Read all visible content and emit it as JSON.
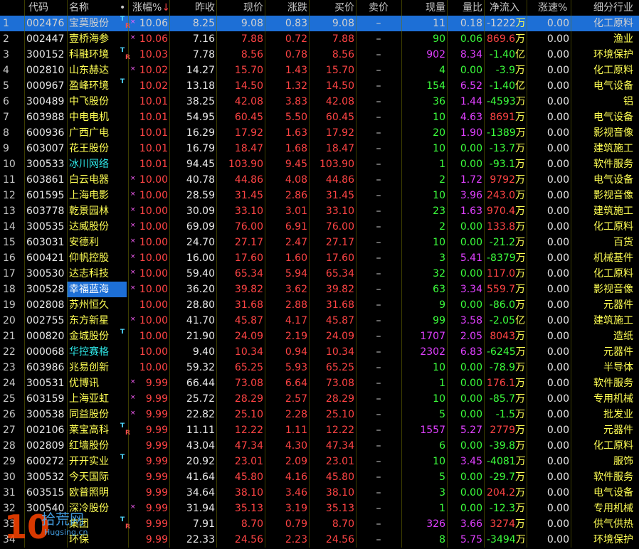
{
  "headers": {
    "idx": "",
    "code": "代码",
    "name": "名称",
    "dot": "•",
    "pct": "涨幅%",
    "pct_arrow": "↓",
    "prev": "昨收",
    "cur": "现价",
    "chg": "涨跌",
    "bid": "买价",
    "ask": "卖价",
    "vol": "现量",
    "ratio": "量比",
    "flow": "净流入",
    "speed": "涨速%",
    "ind": "细分行业"
  },
  "colors": {
    "up": "#ff4444",
    "flat": "#e8e8e8",
    "selected_row": "#1d6fd6",
    "industry": "#ffff54"
  },
  "rows": [
    {
      "idx": "1",
      "code": "002476",
      "name": "宝莫股份",
      "t": true,
      "r": true,
      "x": true,
      "pct": "10.06",
      "prev": "8.25",
      "cur": "9.08",
      "chg": "0.83",
      "bid": "9.08",
      "ask": "–",
      "vol": "11",
      "ratio": "0.18",
      "flow_n": "-1222",
      "flow_u": "万",
      "speed": "0.00",
      "ind": "化工原料",
      "sel": true
    },
    {
      "idx": "2",
      "code": "002447",
      "name": "壹桥海参",
      "t": false,
      "r": false,
      "x": true,
      "pct": "10.06",
      "prev": "7.16",
      "cur": "7.88",
      "chg": "0.72",
      "bid": "7.88",
      "ask": "–",
      "vol": "90",
      "ratio": "0.06",
      "flow_n": "869.6",
      "flow_u": "万",
      "speed": "0.00",
      "ind": "渔业"
    },
    {
      "idx": "3",
      "code": "300152",
      "name": "科融环境",
      "t": true,
      "r": true,
      "x": false,
      "pct": "10.03",
      "prev": "7.78",
      "cur": "8.56",
      "chg": "0.78",
      "bid": "8.56",
      "ask": "–",
      "vol": "902",
      "ratio": "8.34",
      "flow_n": "-1.40",
      "flow_u": "亿",
      "speed": "0.00",
      "ind": "环境保护"
    },
    {
      "idx": "4",
      "code": "002810",
      "name": "山东赫达",
      "t": false,
      "r": false,
      "x": true,
      "pct": "10.02",
      "prev": "14.27",
      "cur": "15.70",
      "chg": "1.43",
      "bid": "15.70",
      "ask": "–",
      "vol": "4",
      "ratio": "0.00",
      "flow_n": "-3.9",
      "flow_u": "万",
      "speed": "0.00",
      "ind": "化工原料"
    },
    {
      "idx": "5",
      "code": "000967",
      "name": "盈峰环境",
      "t": true,
      "r": false,
      "x": false,
      "pct": "10.02",
      "prev": "13.18",
      "cur": "14.50",
      "chg": "1.32",
      "bid": "14.50",
      "ask": "–",
      "vol": "154",
      "ratio": "6.52",
      "flow_n": "-1.40",
      "flow_u": "亿",
      "speed": "0.00",
      "ind": "电气设备"
    },
    {
      "idx": "6",
      "code": "300489",
      "name": "中飞股份",
      "t": false,
      "r": false,
      "x": false,
      "pct": "10.01",
      "prev": "38.25",
      "cur": "42.08",
      "chg": "3.83",
      "bid": "42.08",
      "ask": "–",
      "vol": "36",
      "ratio": "1.44",
      "flow_n": "-4593",
      "flow_u": "万",
      "speed": "0.00",
      "ind": "铝"
    },
    {
      "idx": "7",
      "code": "603988",
      "name": "中电电机",
      "t": false,
      "r": false,
      "x": false,
      "pct": "10.01",
      "prev": "54.95",
      "cur": "60.45",
      "chg": "5.50",
      "bid": "60.45",
      "ask": "–",
      "vol": "10",
      "ratio": "4.63",
      "flow_n": "8691",
      "flow_u": "万",
      "speed": "0.00",
      "ind": "电气设备"
    },
    {
      "idx": "8",
      "code": "600936",
      "name": "广西广电",
      "t": false,
      "r": false,
      "x": false,
      "pct": "10.01",
      "prev": "16.29",
      "cur": "17.92",
      "chg": "1.63",
      "bid": "17.92",
      "ask": "–",
      "vol": "20",
      "ratio": "1.90",
      "flow_n": "-1389",
      "flow_u": "万",
      "speed": "0.00",
      "ind": "影视音像"
    },
    {
      "idx": "9",
      "code": "603007",
      "name": "花王股份",
      "t": false,
      "r": false,
      "x": false,
      "pct": "10.01",
      "prev": "16.79",
      "cur": "18.47",
      "chg": "1.68",
      "bid": "18.47",
      "ask": "–",
      "vol": "10",
      "ratio": "0.00",
      "flow_n": "-13.7",
      "flow_u": "万",
      "speed": "0.00",
      "ind": "建筑施工"
    },
    {
      "idx": "10",
      "code": "300533",
      "name": "冰川网络",
      "t": false,
      "r": false,
      "x": false,
      "teal": true,
      "pct": "10.01",
      "prev": "94.45",
      "cur": "103.90",
      "chg": "9.45",
      "bid": "103.90",
      "ask": "–",
      "vol": "1",
      "ratio": "0.00",
      "flow_n": "-93.1",
      "flow_u": "万",
      "speed": "0.00",
      "ind": "软件服务"
    },
    {
      "idx": "11",
      "code": "603861",
      "name": "白云电器",
      "t": false,
      "r": false,
      "x": true,
      "pct": "10.00",
      "prev": "40.78",
      "cur": "44.86",
      "chg": "4.08",
      "bid": "44.86",
      "ask": "–",
      "vol": "2",
      "ratio": "1.72",
      "flow_n": "9792",
      "flow_u": "万",
      "speed": "0.00",
      "ind": "电气设备"
    },
    {
      "idx": "12",
      "code": "601595",
      "name": "上海电影",
      "t": false,
      "r": false,
      "x": true,
      "pct": "10.00",
      "prev": "28.59",
      "cur": "31.45",
      "chg": "2.86",
      "bid": "31.45",
      "ask": "–",
      "vol": "10",
      "ratio": "3.96",
      "flow_n": "243.0",
      "flow_u": "万",
      "speed": "0.00",
      "ind": "影视音像"
    },
    {
      "idx": "13",
      "code": "603778",
      "name": "乾景园林",
      "t": false,
      "r": false,
      "x": true,
      "pct": "10.00",
      "prev": "30.09",
      "cur": "33.10",
      "chg": "3.01",
      "bid": "33.10",
      "ask": "–",
      "vol": "23",
      "ratio": "1.63",
      "flow_n": "970.4",
      "flow_u": "万",
      "speed": "0.00",
      "ind": "建筑施工"
    },
    {
      "idx": "14",
      "code": "300535",
      "name": "达威股份",
      "t": false,
      "r": false,
      "x": true,
      "pct": "10.00",
      "prev": "69.09",
      "cur": "76.00",
      "chg": "6.91",
      "bid": "76.00",
      "ask": "–",
      "vol": "2",
      "ratio": "0.00",
      "flow_n": "133.8",
      "flow_u": "万",
      "speed": "0.00",
      "ind": "化工原料"
    },
    {
      "idx": "15",
      "code": "603031",
      "name": "安德利",
      "t": false,
      "r": false,
      "x": true,
      "pct": "10.00",
      "prev": "24.70",
      "cur": "27.17",
      "chg": "2.47",
      "bid": "27.17",
      "ask": "–",
      "vol": "10",
      "ratio": "0.00",
      "flow_n": "-21.2",
      "flow_u": "万",
      "speed": "0.00",
      "ind": "百货"
    },
    {
      "idx": "16",
      "code": "600421",
      "name": "仰帆控股",
      "t": false,
      "r": false,
      "x": true,
      "pct": "10.00",
      "prev": "16.00",
      "cur": "17.60",
      "chg": "1.60",
      "bid": "17.60",
      "ask": "–",
      "vol": "3",
      "ratio": "5.41",
      "flow_n": "-8379",
      "flow_u": "万",
      "speed": "0.00",
      "ind": "机械基件"
    },
    {
      "idx": "17",
      "code": "300530",
      "name": "达志科技",
      "t": false,
      "r": false,
      "x": true,
      "pct": "10.00",
      "prev": "59.40",
      "cur": "65.34",
      "chg": "5.94",
      "bid": "65.34",
      "ask": "–",
      "vol": "32",
      "ratio": "0.00",
      "flow_n": "117.0",
      "flow_u": "万",
      "speed": "0.00",
      "ind": "化工原料"
    },
    {
      "idx": "18",
      "code": "300528",
      "name": "幸福蓝海",
      "hl": true,
      "t": false,
      "r": false,
      "x": true,
      "pct": "10.00",
      "prev": "36.20",
      "cur": "39.82",
      "chg": "3.62",
      "bid": "39.82",
      "ask": "–",
      "vol": "63",
      "ratio": "3.34",
      "flow_n": "559.7",
      "flow_u": "万",
      "speed": "0.00",
      "ind": "影视音像"
    },
    {
      "idx": "19",
      "code": "002808",
      "name": "苏州恒久",
      "t": false,
      "r": false,
      "x": false,
      "pct": "10.00",
      "prev": "28.80",
      "cur": "31.68",
      "chg": "2.88",
      "bid": "31.68",
      "ask": "–",
      "vol": "9",
      "ratio": "0.00",
      "flow_n": "-86.0",
      "flow_u": "万",
      "speed": "0.00",
      "ind": "元器件"
    },
    {
      "idx": "20",
      "code": "002755",
      "name": "东方新星",
      "t": false,
      "r": false,
      "x": true,
      "pct": "10.00",
      "prev": "41.70",
      "cur": "45.87",
      "chg": "4.17",
      "bid": "45.87",
      "ask": "–",
      "vol": "99",
      "ratio": "3.58",
      "flow_n": "-2.05",
      "flow_u": "亿",
      "speed": "0.00",
      "ind": "建筑施工"
    },
    {
      "idx": "21",
      "code": "000820",
      "name": "金城股份",
      "t": true,
      "r": false,
      "x": false,
      "pct": "10.00",
      "prev": "21.90",
      "cur": "24.09",
      "chg": "2.19",
      "bid": "24.09",
      "ask": "–",
      "vol": "1707",
      "ratio": "2.05",
      "flow_n": "8043",
      "flow_u": "万",
      "speed": "0.00",
      "ind": "造纸"
    },
    {
      "idx": "22",
      "code": "000068",
      "name": "华控赛格",
      "t": false,
      "r": false,
      "x": false,
      "teal": true,
      "pct": "10.00",
      "prev": "9.40",
      "cur": "10.34",
      "chg": "0.94",
      "bid": "10.34",
      "ask": "–",
      "vol": "2302",
      "ratio": "6.83",
      "flow_n": "-6245",
      "flow_u": "万",
      "speed": "0.00",
      "ind": "元器件"
    },
    {
      "idx": "23",
      "code": "603986",
      "name": "兆易创新",
      "t": false,
      "r": false,
      "x": false,
      "pct": "10.00",
      "prev": "59.32",
      "cur": "65.25",
      "chg": "5.93",
      "bid": "65.25",
      "ask": "–",
      "vol": "10",
      "ratio": "0.00",
      "flow_n": "-78.9",
      "flow_u": "万",
      "speed": "0.00",
      "ind": "半导体"
    },
    {
      "idx": "24",
      "code": "300531",
      "name": "优博讯",
      "t": false,
      "r": false,
      "x": true,
      "pct": "9.99",
      "prev": "66.44",
      "cur": "73.08",
      "chg": "6.64",
      "bid": "73.08",
      "ask": "–",
      "vol": "1",
      "ratio": "0.00",
      "flow_n": "176.1",
      "flow_u": "万",
      "speed": "0.00",
      "ind": "软件服务"
    },
    {
      "idx": "25",
      "code": "603159",
      "name": "上海亚虹",
      "t": false,
      "r": false,
      "x": true,
      "pct": "9.99",
      "prev": "25.72",
      "cur": "28.29",
      "chg": "2.57",
      "bid": "28.29",
      "ask": "–",
      "vol": "10",
      "ratio": "0.00",
      "flow_n": "-85.7",
      "flow_u": "万",
      "speed": "0.00",
      "ind": "专用机械"
    },
    {
      "idx": "26",
      "code": "300538",
      "name": "同益股份",
      "t": false,
      "r": false,
      "x": true,
      "pct": "9.99",
      "prev": "22.82",
      "cur": "25.10",
      "chg": "2.28",
      "bid": "25.10",
      "ask": "–",
      "vol": "5",
      "ratio": "0.00",
      "flow_n": "-1.5",
      "flow_u": "万",
      "speed": "0.00",
      "ind": "批发业"
    },
    {
      "idx": "27",
      "code": "002106",
      "name": "莱宝高科",
      "t": true,
      "r": true,
      "x": false,
      "pct": "9.99",
      "prev": "11.11",
      "cur": "12.22",
      "chg": "1.11",
      "bid": "12.22",
      "ask": "–",
      "vol": "1557",
      "ratio": "5.27",
      "flow_n": "2779",
      "flow_u": "万",
      "speed": "0.00",
      "ind": "元器件"
    },
    {
      "idx": "28",
      "code": "002809",
      "name": "红墙股份",
      "t": false,
      "r": false,
      "x": false,
      "pct": "9.99",
      "prev": "43.04",
      "cur": "47.34",
      "chg": "4.30",
      "bid": "47.34",
      "ask": "–",
      "vol": "6",
      "ratio": "0.00",
      "flow_n": "-39.8",
      "flow_u": "万",
      "speed": "0.00",
      "ind": "化工原料"
    },
    {
      "idx": "29",
      "code": "600272",
      "name": "开开实业",
      "t": true,
      "r": false,
      "x": false,
      "pct": "9.99",
      "prev": "20.92",
      "cur": "23.01",
      "chg": "2.09",
      "bid": "23.01",
      "ask": "–",
      "vol": "10",
      "ratio": "3.45",
      "flow_n": "-4081",
      "flow_u": "万",
      "speed": "0.00",
      "ind": "服饰"
    },
    {
      "idx": "30",
      "code": "300532",
      "name": "今天国际",
      "t": false,
      "r": false,
      "x": false,
      "pct": "9.99",
      "prev": "41.64",
      "cur": "45.80",
      "chg": "4.16",
      "bid": "45.80",
      "ask": "–",
      "vol": "5",
      "ratio": "0.00",
      "flow_n": "-29.7",
      "flow_u": "万",
      "speed": "0.00",
      "ind": "软件服务"
    },
    {
      "idx": "31",
      "code": "603515",
      "name": "欧普照明",
      "t": false,
      "r": false,
      "x": false,
      "pct": "9.99",
      "prev": "34.64",
      "cur": "38.10",
      "chg": "3.46",
      "bid": "38.10",
      "ask": "–",
      "vol": "3",
      "ratio": "0.00",
      "flow_n": "204.2",
      "flow_u": "万",
      "speed": "0.00",
      "ind": "电气设备"
    },
    {
      "idx": "32",
      "code": "300540",
      "name": "深冷股份",
      "t": false,
      "r": false,
      "x": true,
      "pct": "9.99",
      "prev": "31.94",
      "cur": "35.13",
      "chg": "3.19",
      "bid": "35.13",
      "ask": "–",
      "vol": "1",
      "ratio": "0.00",
      "flow_n": "-12.3",
      "flow_u": "万",
      "speed": "0.00",
      "ind": "专用机械"
    },
    {
      "idx": "33",
      "code": "",
      "name": "集团",
      "t": true,
      "r": true,
      "x": false,
      "pct": "9.99",
      "prev": "7.91",
      "cur": "8.70",
      "chg": "0.79",
      "bid": "8.70",
      "ask": "–",
      "vol": "326",
      "ratio": "3.66",
      "flow_n": "3274",
      "flow_u": "万",
      "speed": "0.00",
      "ind": "供气供热"
    },
    {
      "idx": "34",
      "code": "",
      "name": "环保",
      "t": false,
      "r": false,
      "x": false,
      "pct": "9.99",
      "prev": "22.33",
      "cur": "24.56",
      "chg": "2.23",
      "bid": "24.56",
      "ask": "–",
      "vol": "8",
      "ratio": "5.75",
      "flow_n": "-3494",
      "flow_u": "万",
      "speed": "0.00",
      "ind": "环境保护"
    }
  ],
  "watermark": {
    "num": "10",
    "name": "拾荒网",
    "url": "Hugsing.cn"
  }
}
